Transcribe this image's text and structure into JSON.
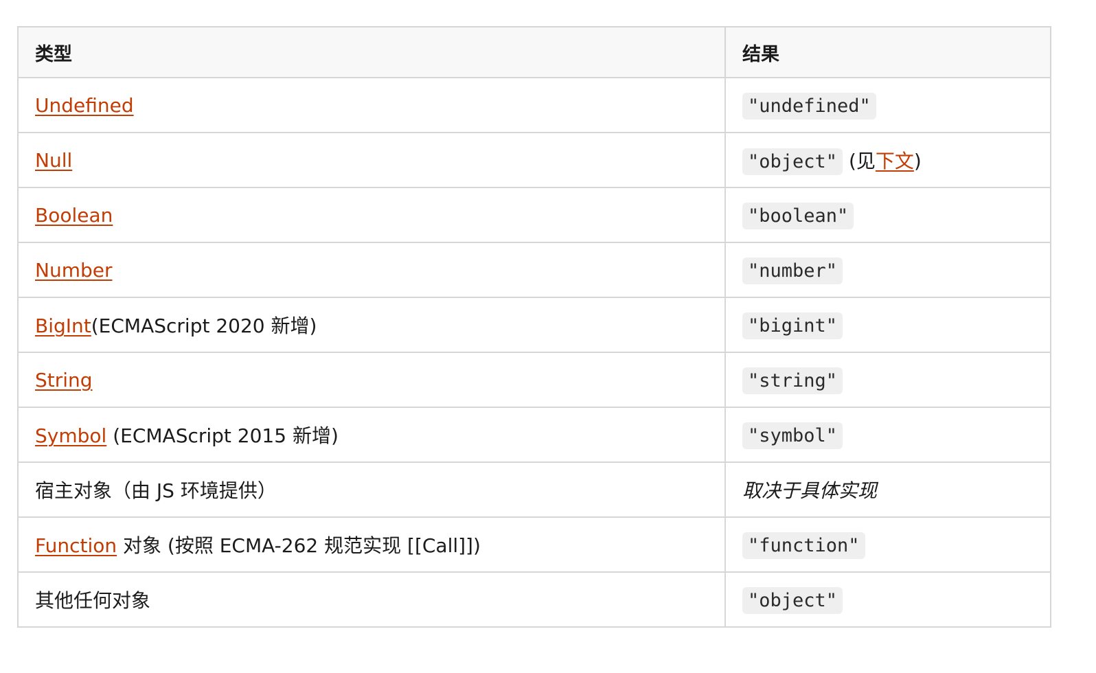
{
  "table": {
    "headers": {
      "type": "类型",
      "result": "结果"
    },
    "rows": [
      {
        "type_link": "Undefined",
        "result_code": "\"undefined\""
      },
      {
        "type_link": "Null",
        "result_code": "\"object\"",
        "result_note_prefix": " (见",
        "result_note_link": "下文",
        "result_note_suffix": ")"
      },
      {
        "type_link": "Boolean",
        "result_code": "\"boolean\""
      },
      {
        "type_link": "Number",
        "result_code": "\"number\""
      },
      {
        "type_link": "BigInt",
        "type_suffix": "(ECMAScript 2020 新增)",
        "result_code": "\"bigint\""
      },
      {
        "type_link": "String",
        "result_code": "\"string\""
      },
      {
        "type_link": "Symbol",
        "type_suffix": " (ECMAScript 2015 新增)",
        "result_code": "\"symbol\""
      },
      {
        "type_text": "宿主对象（由 JS 环境提供）",
        "result_text": "取决于具体实现"
      },
      {
        "type_link": "Function",
        "type_suffix": " 对象 (按照 ECMA-262 规范实现 [[Call]])",
        "result_code": "\"function\""
      },
      {
        "type_text": "其他任何对象",
        "result_code": "\"object\""
      }
    ]
  },
  "colors": {
    "link": "#c23d04",
    "border": "#d6d6d6",
    "header_bg": "#f8f8f8",
    "code_bg": "#efefef"
  }
}
